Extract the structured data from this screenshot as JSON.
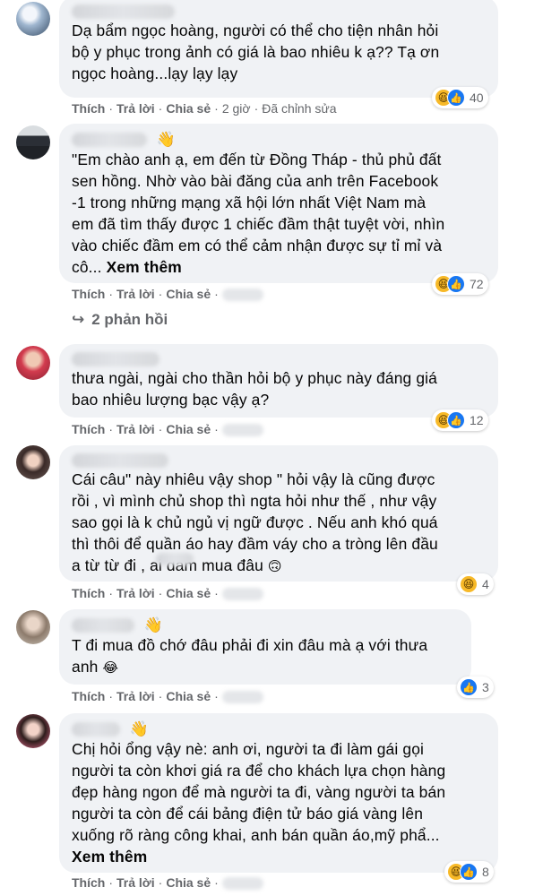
{
  "actions": {
    "like": "Thích",
    "reply": "Trả lời",
    "share": "Chia sẻ",
    "dot": "·"
  },
  "comments": [
    {
      "text": "Dạ bẩm ngọc hoàng, người có thể cho tiện nhân hỏi\nbộ y phục trong ảnh có giá là bao nhiêu k ạ?? Tạ ơn\nngọc hoàng...lạy lạy lạy",
      "time": "2 giờ",
      "edited": "Đã chỉnh sửa",
      "reaction_count": "40",
      "reactions": [
        "haha",
        "like"
      ]
    },
    {
      "text": "\"Em chào anh ạ, em đến từ Đồng Tháp - thủ phủ đất\nsen hồng. Nhờ vào bài đăng của anh trên Facebook\n-1 trong những mạng xã hội lớn nhất Việt Nam mà\nem đã tìm thấy được 1 chiếc đầm thật tuyệt vời, nhìn\nvào chiếc đầm em có thể cảm nhận được sự tỉ mỉ và\ncô... ",
      "see_more": "Xem thêm",
      "reaction_count": "72",
      "reactions": [
        "haha",
        "like"
      ],
      "replies": "2 phản hồi"
    },
    {
      "text": "thưa ngài, ngài cho thần hỏi bộ y phục này đáng giá\nbao nhiêu lượng bạc vậy ạ?",
      "reaction_count": "12",
      "reactions": [
        "haha",
        "like"
      ]
    },
    {
      "text": "Cái câu\" này nhiêu vậy shop \" hỏi vậy là cũng được\nrồi , vì mình chủ shop thì ngta hỏi như thế , như vậy\nsao gọi là k chủ ngủ vị ngữ được . Nếu anh khó quá\nthì thôi để quần áo hay đầm váy cho a tròng lên đầu\na từ từ đi ,      ai dám mua đâu ",
      "emoji": "🙃",
      "reaction_count": "4",
      "reactions": [
        "haha"
      ]
    },
    {
      "text": "T đi mua đồ chớ đâu phải đi xin đâu mà ạ với thưa\nanh ",
      "emoji": "😂",
      "reaction_count": "3",
      "reactions": [
        "like"
      ]
    },
    {
      "text": "Chị hỏi ổng vậy nè: anh ơi, người ta đi làm gái gọi\nngười ta còn khơi giá ra để cho khách lựa chọn hàng\nđẹp hàng ngon để mà người ta đi, vàng người ta bán\nngười ta còn để cái bảng điện tử báo giá vàng lên\nxuống rõ ràng công khai, anh bán quần áo,mỹ phẩ...",
      "see_more": "Xem thêm",
      "reaction_count": "8",
      "reactions": [
        "haha",
        "like"
      ]
    }
  ],
  "colors": {
    "bubble": "#f0f2f5",
    "meta": "#65676b",
    "like": "#1877f2",
    "haha": "#f7b928"
  },
  "icons": {
    "reply_arrow": "reply-arrow-icon",
    "wave": "wave-hand-icon"
  }
}
